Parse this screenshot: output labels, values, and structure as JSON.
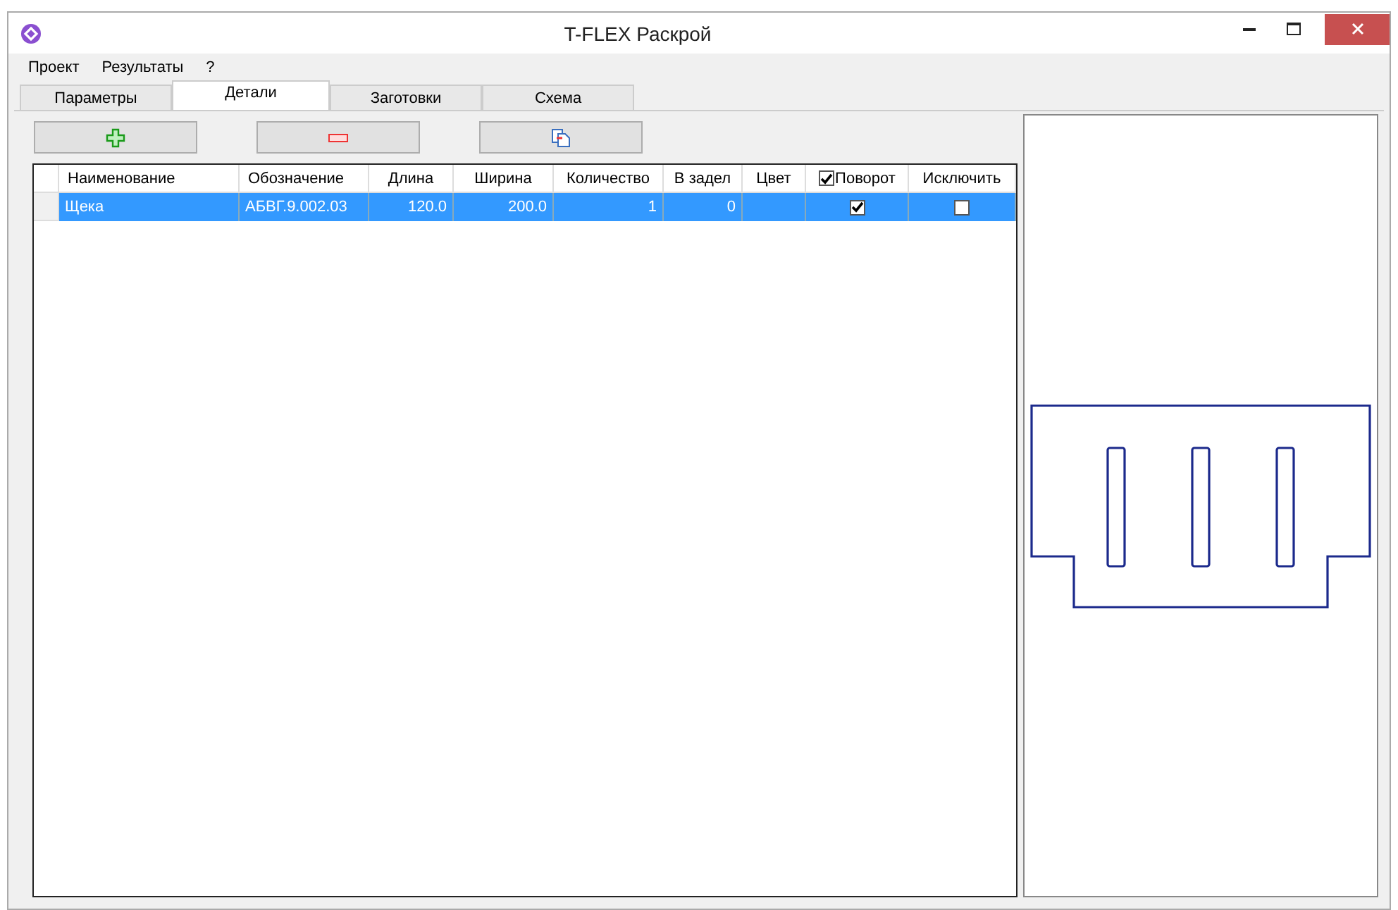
{
  "window": {
    "title": "T-FLEX Раскрой"
  },
  "menu": [
    "Проект",
    "Результаты",
    "?"
  ],
  "tabs": [
    {
      "label": "Параметры",
      "selected": false
    },
    {
      "label": "Детали",
      "selected": true
    },
    {
      "label": "Заготовки",
      "selected": false
    },
    {
      "label": "Схема",
      "selected": false
    }
  ],
  "toolbar": [
    {
      "kind": "add"
    },
    {
      "kind": "remove"
    },
    {
      "kind": "copy"
    }
  ],
  "table": {
    "columns": [
      {
        "label": "Наименование",
        "kind": "text"
      },
      {
        "label": "Обозначение",
        "kind": "text"
      },
      {
        "label": "Длина",
        "kind": "number"
      },
      {
        "label": "Ширина",
        "kind": "number"
      },
      {
        "label": "Количество",
        "kind": "number"
      },
      {
        "label": "В задел",
        "kind": "number"
      },
      {
        "label": "Цвет",
        "kind": "color"
      },
      {
        "label": "Поворот",
        "kind": "check",
        "header_checked": true
      },
      {
        "label": "Исключить",
        "kind": "check"
      }
    ],
    "rows": [
      {
        "selected": true,
        "cells": [
          {
            "text": "Щека"
          },
          {
            "text": "АБВГ.9.002.03"
          },
          {
            "text": "120.0"
          },
          {
            "text": "200.0"
          },
          {
            "text": "1"
          },
          {
            "text": "0"
          },
          {},
          {
            "checked": true
          },
          {
            "checked": false
          }
        ]
      }
    ]
  }
}
